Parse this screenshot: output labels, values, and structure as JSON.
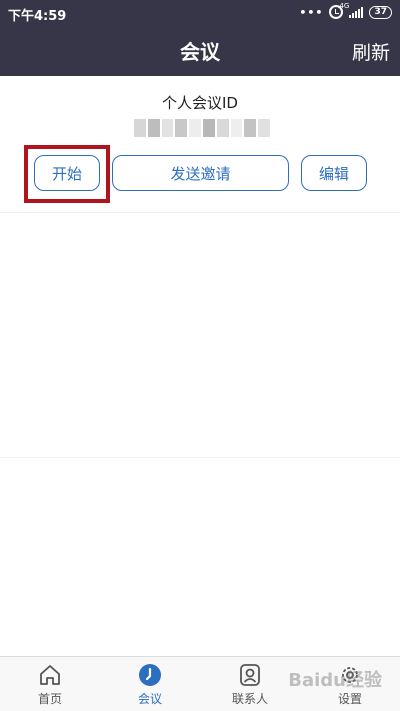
{
  "status_bar": {
    "time": "下午4:59",
    "network": "4G",
    "battery": "37"
  },
  "header": {
    "title": "会议",
    "refresh_label": "刷新"
  },
  "meeting": {
    "label": "个人会议ID"
  },
  "actions": {
    "start_label": "开始",
    "invite_label": "发送邀请",
    "edit_label": "编辑"
  },
  "tabs": [
    {
      "label": "首页",
      "icon": "home-icon",
      "active": false
    },
    {
      "label": "会议",
      "icon": "clock-icon",
      "active": true
    },
    {
      "label": "联系人",
      "icon": "contact-icon",
      "active": false
    },
    {
      "label": "设置",
      "icon": "gear-icon",
      "active": false
    }
  ],
  "watermark": "Baidu经验",
  "colors": {
    "header_bg": "#363648",
    "accent": "#2d6fbf",
    "highlight_box": "#b0141c"
  }
}
